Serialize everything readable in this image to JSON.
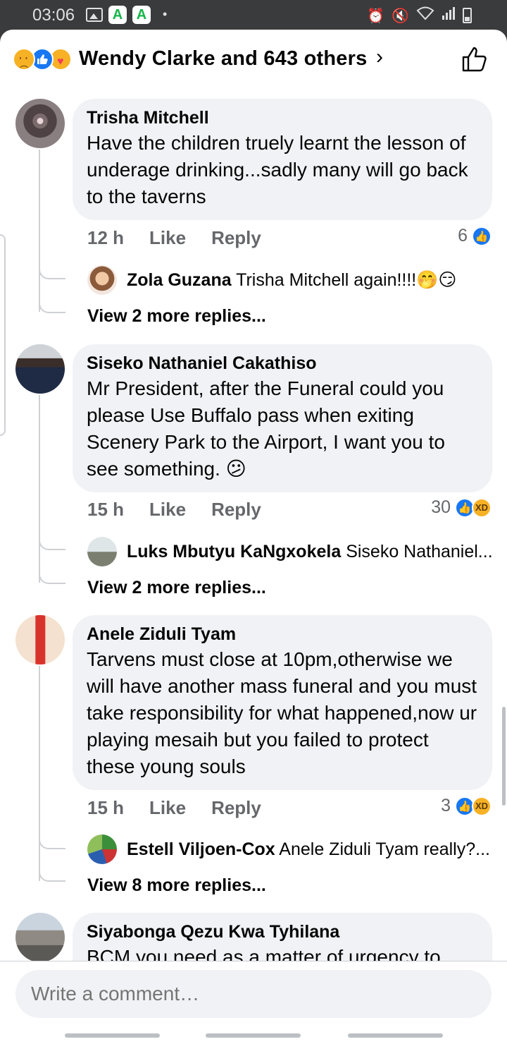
{
  "status_bar": {
    "time": "03:06",
    "app_badge_1": "A",
    "app_badge_2": "A",
    "dot": "•",
    "right_icons": "⏰ 🔇 📶"
  },
  "header": {
    "title": "Wendy Clarke and 643 others",
    "chevron": "›",
    "reaction_icons": [
      "sad-icon",
      "like-icon",
      "care-icon"
    ],
    "like_icon": "thumbs-up-outline-icon"
  },
  "comments": [
    {
      "author": "Trisha Mitchell",
      "text": "Have the children  truely learnt the lesson of underage drinking...sadly many will go back to the taverns",
      "time": "12 h",
      "like_label": "Like",
      "reply_label": "Reply",
      "reaction_count": "6",
      "reply_preview_author": "Zola Guzana",
      "reply_preview_text": "Trisha Mitchell again!!!!🤭😏",
      "view_more": "View 2 more replies..."
    },
    {
      "author": "Siseko Nathaniel Cakathiso",
      "text": "Mr President, after the Funeral could you please Use Buffalo pass when exiting Scenery Park to the Airport, I want you to see something. 😕",
      "time": "15 h",
      "like_label": "Like",
      "reply_label": "Reply",
      "reaction_count": "30",
      "reply_preview_author": "Luks Mbutyu KaNgxokela",
      "reply_preview_text": "Siseko Nathaniel...",
      "view_more": "View 2 more replies..."
    },
    {
      "author": "Anele Ziduli Tyam",
      "text": "Tarvens must close at 10pm,otherwise we will have another mass funeral and you must take responsibility for what happened,now ur playing mesaih but you failed to protect these young souls",
      "time": "15 h",
      "like_label": "Like",
      "reply_label": "Reply",
      "reaction_count": "3",
      "reply_preview_author": "Estell Viljoen-Cox",
      "reply_preview_text": "Anele Ziduli Tyam really?...",
      "view_more": "View 8 more replies..."
    },
    {
      "author": "Siyabonga Qezu Kwa Tyhilana",
      "text": "BCM you need as a matter of urgency to"
    }
  ],
  "composer": {
    "placeholder": "Write a comment…"
  },
  "colors": {
    "facebook_blue": "#1877f2",
    "bubble_bg": "#f0f2f5",
    "secondary_text": "#65676b"
  }
}
